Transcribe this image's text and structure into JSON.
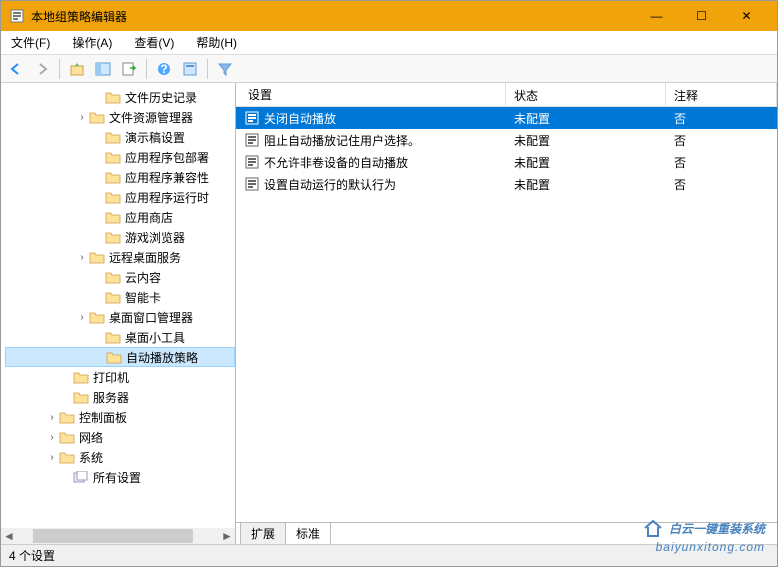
{
  "window": {
    "title": "本地组策略编辑器",
    "min": "—",
    "max": "☐",
    "close": "✕"
  },
  "menu": {
    "file": "文件(F)",
    "action": "操作(A)",
    "view": "查看(V)",
    "help": "帮助(H)"
  },
  "tree": {
    "items": [
      {
        "label": "文件历史记录",
        "indent": "indent-2"
      },
      {
        "label": "文件资源管理器",
        "indent": "indent-1",
        "expander": "›"
      },
      {
        "label": "演示稿设置",
        "indent": "indent-2"
      },
      {
        "label": "应用程序包部署",
        "indent": "indent-2"
      },
      {
        "label": "应用程序兼容性",
        "indent": "indent-2"
      },
      {
        "label": "应用程序运行时",
        "indent": "indent-2"
      },
      {
        "label": "应用商店",
        "indent": "indent-2"
      },
      {
        "label": "游戏浏览器",
        "indent": "indent-2"
      },
      {
        "label": "远程桌面服务",
        "indent": "indent-1",
        "expander": "›"
      },
      {
        "label": "云内容",
        "indent": "indent-2"
      },
      {
        "label": "智能卡",
        "indent": "indent-2"
      },
      {
        "label": "桌面窗口管理器",
        "indent": "indent-1",
        "expander": "›"
      },
      {
        "label": "桌面小工具",
        "indent": "indent-2"
      },
      {
        "label": "自动播放策略",
        "indent": "indent-2",
        "selected": true
      },
      {
        "label": "打印机",
        "indent": "indent-0b"
      },
      {
        "label": "服务器",
        "indent": "indent-0b"
      },
      {
        "label": "控制面板",
        "indent": "indent-0b",
        "expander_before": "›"
      },
      {
        "label": "网络",
        "indent": "indent-0b",
        "expander_before": "›"
      },
      {
        "label": "系统",
        "indent": "indent-0b",
        "expander_before": "›"
      },
      {
        "label": "所有设置",
        "indent": "indent-0b",
        "all": true
      }
    ]
  },
  "list": {
    "columns": {
      "name": "设置",
      "state": "状态",
      "comment": "注释"
    },
    "rows": [
      {
        "name": "关闭自动播放",
        "state": "未配置",
        "comment": "否",
        "selected": true
      },
      {
        "name": "阻止自动播放记住用户选择。",
        "state": "未配置",
        "comment": "否"
      },
      {
        "name": "不允许非卷设备的自动播放",
        "state": "未配置",
        "comment": "否"
      },
      {
        "name": "设置自动运行的默认行为",
        "state": "未配置",
        "comment": "否"
      }
    ]
  },
  "tabs": {
    "extended": "扩展",
    "standard": "标准"
  },
  "status": {
    "text": "4 个设置"
  },
  "watermark": {
    "main": "白云一键重装系统",
    "url": "baiyunxitong.com"
  }
}
